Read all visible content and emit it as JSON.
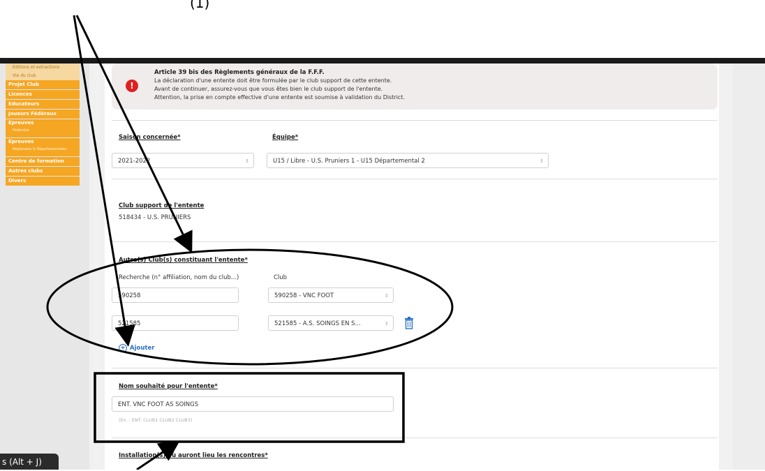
{
  "sidebar": {
    "top_items": [
      "Editions et extractions",
      "Vie du club"
    ],
    "items": [
      {
        "label": "Projet Club"
      },
      {
        "label": "Licences"
      },
      {
        "label": "Educateurs"
      },
      {
        "label": "Joueurs Fédéraux"
      },
      {
        "label": "Epreuves",
        "sub": "Fédérales"
      },
      {
        "label": "Epreuves",
        "sub": "Régionales & Départementales"
      },
      {
        "label": "Centre de formation"
      },
      {
        "label": "Autres clubs"
      },
      {
        "label": "Divers"
      }
    ]
  },
  "alert": {
    "title": "Article 39 bis des Règlements généraux de la F.F.F.",
    "lines": [
      "La déclaration d'une entente doit être formulée par le club support de cette entente.",
      "Avant de continuer, assurez-vous que vous êtes bien le club support de l'entente.",
      "Attention, la prise en compte effective d'une entente est soumise à validation du District."
    ]
  },
  "form": {
    "season_label": "Saison concernée*",
    "season_value": "2021-2022",
    "team_label": "Équipe*",
    "team_value": "U15 / Libre - U.S. Pruniers 1 - U15 Départemental 2",
    "support_label": "Club support de l'entente",
    "support_value": "518434 - U.S. PRUNIERS",
    "others_label": "Autre(s) Club(s) constituant l'entente*",
    "search_col_label": "Recherche (n° affiliation, nom du club...)",
    "club_col_label": "Club",
    "rows": [
      {
        "search": "590258",
        "club": "590258 - VNC FOOT"
      },
      {
        "search": "521585",
        "club": "521585 - A.S. SOINGS EN S..."
      }
    ],
    "add_label": "Ajouter",
    "name_label": "Nom souhaité pour l'entente*",
    "name_value": "ENT. VNC FOOT AS SOINGS",
    "name_hint": "(Ex. : ENT. CLUB1 CLUB2 CLUB3)",
    "install_label": "Installation(s) où auront lieu les rencontres*"
  },
  "overlay": {
    "shortcut_text": "s (Alt + J)",
    "top_text": "(1)"
  },
  "colors": {
    "menu_orange": "#f5a623",
    "alert_red": "#e02020",
    "link_blue": "#2a6fc4"
  }
}
